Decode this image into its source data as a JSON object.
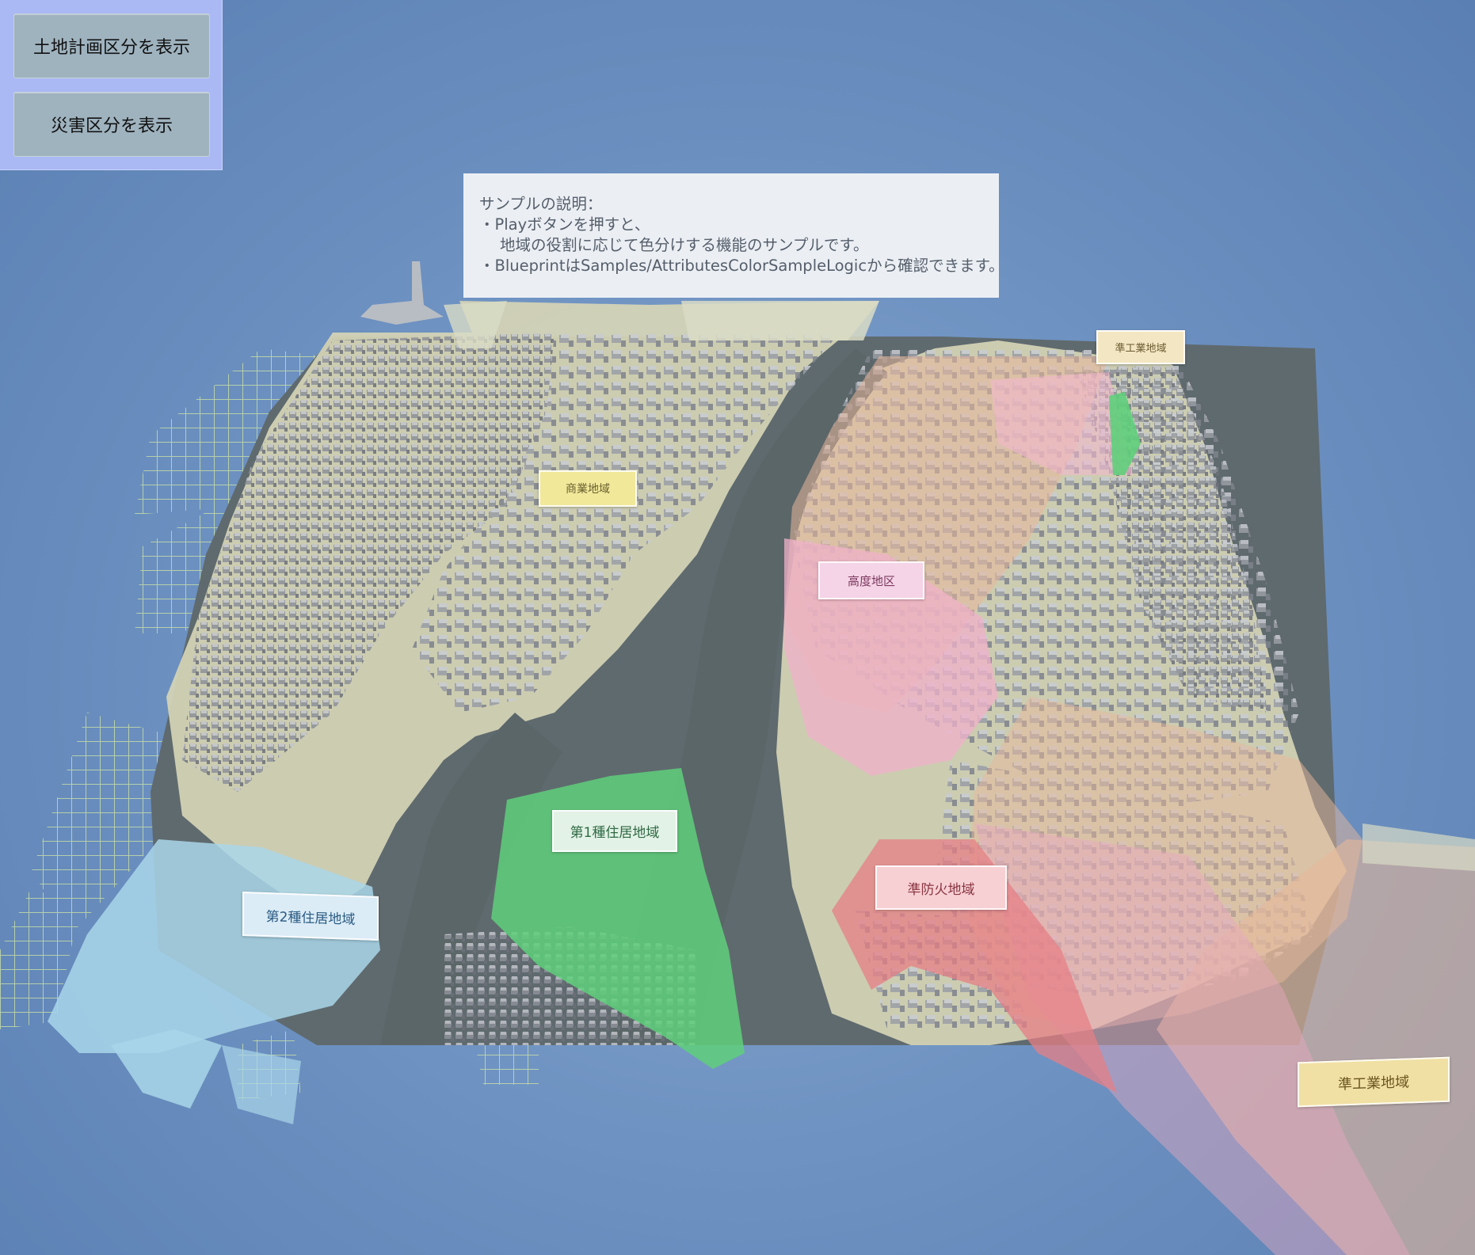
{
  "toolbar": {
    "land_plan_button": "土地計画区分を表示",
    "disaster_button": "災害区分を表示"
  },
  "description": {
    "line1": "サンプルの説明：",
    "line2": "・Playボタンを押すと、",
    "line3": "地域の役割に応じて色分けする機能のサンプルです。",
    "line4": "・BlueprintはSamples/AttributesColorSampleLogicから確認できます。"
  },
  "map_labels": {
    "commercial": "商業地域",
    "height_district": "高度地区",
    "residential_1": "第1種住居地域",
    "residential_2": "第2種住居地域",
    "quasi_fire": "準防火地域",
    "quasi_industrial_top": "準工業地域",
    "quasi_industrial_bottom": "準工業地域"
  },
  "colors": {
    "sky": "#6f93c2",
    "ui_panel": "#aab8f4",
    "ui_button": "#9fb3bf",
    "commercial_zone": "#e8e3b4",
    "height_zone": "#f0b8cc",
    "residential_1_zone": "#5fcf7b",
    "residential_2_zone": "#a9d6ea",
    "quasi_fire_zone": "#e57f86",
    "quasi_industrial_zone": "#e6b79a",
    "water": "#5f6a6e"
  }
}
